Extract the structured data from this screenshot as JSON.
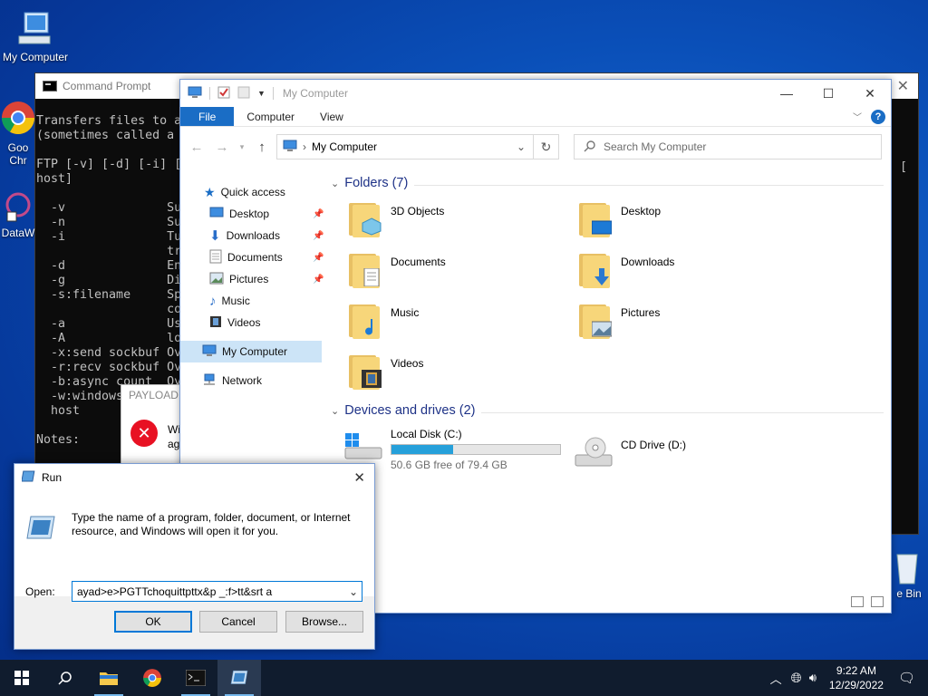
{
  "desktop": {
    "icons": [
      {
        "label": "My Computer"
      },
      {
        "label": "Goo Chr"
      },
      {
        "label": "DataW"
      },
      {
        "label": "e Bin"
      }
    ]
  },
  "cmd": {
    "title": "Command Prompt",
    "text": "Transfers files to a\n(sometimes called a \n\nFTP [-v] [-d] [-i] [\nhost]\n\n  -v              Su\n  -n              Su\n  -i              Tu\n                  tr\n  -d              En\n  -g              Di\n  -s:filename     Sp\n                  co\n  -a              Us\n  -A              lo\n  -x:send sockbuf Ov\n  -r:recv sockbuf Ov\n  -b:async count  Ov\n  -w:windowsize   Ov\n  host\n\nNotes:",
    "right_bracket": "["
  },
  "error_popup": {
    "title": "PAYLOAD.E",
    "text_line1": "Wi",
    "text_line2": "ag"
  },
  "explorer": {
    "title": "My Computer",
    "ribbon": {
      "file": "File",
      "computer": "Computer",
      "view": "View"
    },
    "address": "My Computer",
    "search_placeholder": "Search My Computer",
    "nav": {
      "quick_access": "Quick access",
      "items": [
        "Desktop",
        "Downloads",
        "Documents",
        "Pictures",
        "Music",
        "Videos"
      ],
      "my_computer": "My Computer",
      "network": "Network"
    },
    "folders_header": "Folders (7)",
    "folders": [
      "3D Objects",
      "Desktop",
      "Documents",
      "Downloads",
      "Music",
      "Pictures",
      "Videos"
    ],
    "drives_header": "Devices and drives (2)",
    "drives": [
      {
        "name": "Local Disk (C:)",
        "free": "50.6 GB free of 79.4 GB",
        "used_fraction": 0.363
      },
      {
        "name": "CD Drive (D:)"
      }
    ]
  },
  "run": {
    "title": "Run",
    "description": "Type the name of a program, folder, document, or Internet resource, and Windows will open it for you.",
    "open_label": "Open:",
    "open_value": "ayad>e>PGTTchoquittpttx&p _:f>tt&srt a",
    "ok": "OK",
    "cancel": "Cancel",
    "browse": "Browse..."
  },
  "taskbar": {
    "time": "9:22 AM",
    "date": "12/29/2022"
  },
  "colors": {
    "accent": "#0078d7",
    "file_tab": "#1a6dc5",
    "drive_fill": "#26a0da"
  }
}
